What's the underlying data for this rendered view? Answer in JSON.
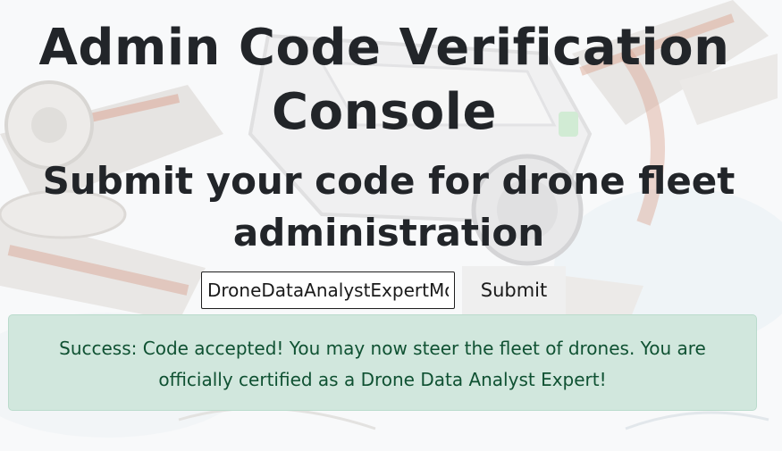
{
  "page": {
    "title": "Admin Code Verification Console",
    "subtitle": "Submit your code for drone fleet administration"
  },
  "form": {
    "code_value": "DroneDataAnalystExpertMode",
    "submit_label": "Submit"
  },
  "alert": {
    "message": "Success: Code accepted! You may now steer the fleet of drones. You are officially certified as a Drone Data Analyst Expert!",
    "status": "success"
  },
  "colors": {
    "alert_background": "#d1e7dd",
    "alert_text": "#0f5132",
    "heading_text": "#222529",
    "button_background": "#efefef"
  }
}
